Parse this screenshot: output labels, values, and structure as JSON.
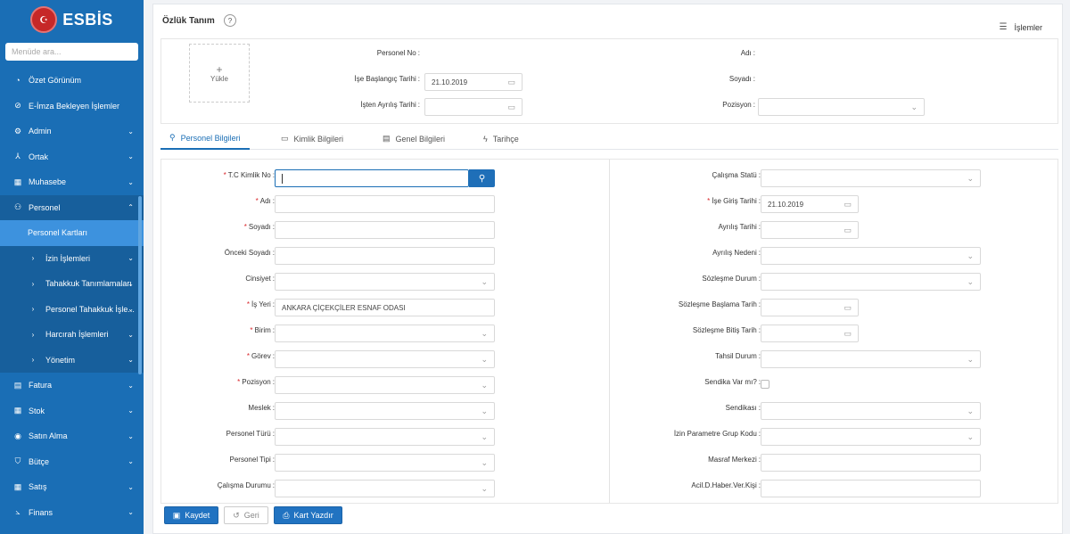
{
  "sidebar": {
    "brand": "ESBİS",
    "search_placeholder": "Menüde ara...",
    "items": [
      {
        "label": "Özet Görünüm",
        "icon": "dashboard-icon"
      },
      {
        "label": "E-İmza Bekleyen İşlemler",
        "icon": "check-circle-icon"
      },
      {
        "label": "Admin",
        "icon": "gear-icon"
      },
      {
        "label": "Ortak",
        "icon": "share-icon"
      },
      {
        "label": "Muhasebe",
        "icon": "calculator-icon"
      },
      {
        "label": "Personel",
        "icon": "users-icon"
      },
      {
        "label": "Personel Kartları"
      },
      {
        "label": "İzin İşlemleri"
      },
      {
        "label": "Tahakkuk Tanımlamaları"
      },
      {
        "label": "Personel Tahakkuk İşle..."
      },
      {
        "label": "Harcırah İşlemleri"
      },
      {
        "label": "Yönetim"
      },
      {
        "label": "Fatura",
        "icon": "invoice-icon"
      },
      {
        "label": "Stok",
        "icon": "grid-icon"
      },
      {
        "label": "Satın Alma",
        "icon": "cart-icon"
      },
      {
        "label": "Bütçe",
        "icon": "shield-icon"
      },
      {
        "label": "Satış",
        "icon": "sales-icon"
      },
      {
        "label": "Finans",
        "icon": "chart-icon"
      }
    ]
  },
  "header": {
    "title": "Özlük Tanım",
    "help": "?",
    "actions_label": "İşlemler"
  },
  "top": {
    "upload_plus": "+",
    "upload_label": "Yükle",
    "personel_no_label": "Personel No",
    "ise_baslangic_label": "İşe Başlangıç Tarihi",
    "ise_baslangic_value": "21.10.2019",
    "isten_ayrilis_label": "İşten Ayrılış Tarihi",
    "adi_label": "Adı",
    "soyadi_label": "Soyadı",
    "pozisyon_label": "Pozisyon"
  },
  "tabs": [
    {
      "label": "Personel Bilgileri",
      "icon": "user-icon"
    },
    {
      "label": "Kimlik Bilgileri",
      "icon": "id-card-icon"
    },
    {
      "label": "Genel Bilgileri",
      "icon": "list-icon"
    },
    {
      "label": "Tarihçe",
      "icon": "history-icon"
    }
  ],
  "left_fields": [
    {
      "label": "T.C Kimlik No",
      "required": true
    },
    {
      "label": "Adı",
      "required": true
    },
    {
      "label": "Soyadı",
      "required": true
    },
    {
      "label": "Önceki Soyadı",
      "required": false
    },
    {
      "label": "Cinsiyet",
      "required": false
    },
    {
      "label": "İş Yeri",
      "required": true,
      "value": "ANKARA ÇİÇEKÇİLER ESNAF ODASI"
    },
    {
      "label": "Birim",
      "required": true
    },
    {
      "label": "Görev",
      "required": true
    },
    {
      "label": "Pozisyon",
      "required": true
    },
    {
      "label": "Meslek",
      "required": false
    },
    {
      "label": "Personel Türü",
      "required": false
    },
    {
      "label": "Personel Tipi",
      "required": false
    },
    {
      "label": "Çalışma Durumu",
      "required": false
    }
  ],
  "right_fields": [
    {
      "label": "Çalışma Statü",
      "required": false
    },
    {
      "label": "İşe Giriş Tarihi",
      "required": true,
      "value": "21.10.2019"
    },
    {
      "label": "Ayrılış Tarihi",
      "required": false
    },
    {
      "label": "Ayrılış Nedeni",
      "required": false
    },
    {
      "label": "Sözleşme Durum",
      "required": false
    },
    {
      "label": "Sözleşme Başlama Tarih",
      "required": false
    },
    {
      "label": "Sözleşme Bitiş Tarih",
      "required": false
    },
    {
      "label": "Tahsil Durum",
      "required": false
    },
    {
      "label": "Sendika Var mı?",
      "required": false
    },
    {
      "label": "Sendikası",
      "required": false
    },
    {
      "label": "İzin Parametre Grup Kodu",
      "required": false
    },
    {
      "label": "Masraf Merkezi",
      "required": false
    },
    {
      "label": "Acil.D.Haber.Ver.Kişi",
      "required": false
    }
  ],
  "required_mark": "*",
  "colon": ":",
  "footer": {
    "save_label": "Kaydet",
    "back_label": "Geri",
    "print_label": "Kart Yazdır"
  }
}
